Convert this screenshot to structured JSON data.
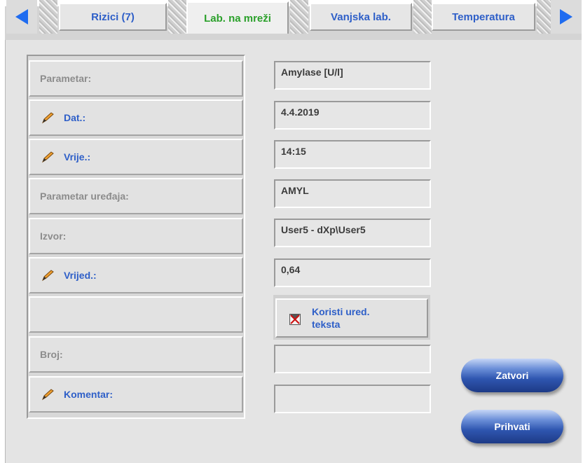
{
  "tabs": [
    {
      "label": "Rizici (7)",
      "active": false
    },
    {
      "label": "Lab. na mreži",
      "active": true
    },
    {
      "label": "Vanjska lab.",
      "active": false
    },
    {
      "label": "Temperatura",
      "active": false
    }
  ],
  "colors": {
    "tab_text": "#2e5fc8",
    "tab_active_text": "#2aa02a",
    "editable_label": "#2e5fc8",
    "static_label": "#8c8c8c",
    "arrow": "#1f6cf0",
    "button_blue": "#2f56b0",
    "checkbox_x": "#cc1010"
  },
  "icons": {
    "prev": "arrow-left-icon",
    "next": "arrow-right-icon",
    "edit": "pencil-icon",
    "checkbox": "checkbox-x-icon"
  },
  "fields": {
    "parameter": {
      "label": "Parametar:",
      "value": "Amylase [U/l]"
    },
    "date": {
      "label": "Dat.:",
      "value": "4.4.2019"
    },
    "time": {
      "label": "Vrije.:",
      "value": "14:15"
    },
    "device_parameter": {
      "label": "Parametar uređaja:",
      "value": "AMYL"
    },
    "source": {
      "label": "Izvor:",
      "value": "User5 - dXp\\User5"
    },
    "value": {
      "label": "Vrijed.:",
      "value": "0,64"
    },
    "number": {
      "label": "Broj:",
      "value": ""
    },
    "comment": {
      "label": "Komentar:",
      "value": ""
    }
  },
  "text_editor": {
    "label": "Koristi ured. teksta",
    "checked": false
  },
  "buttons": {
    "close": "Zatvori",
    "accept": "Prihvati"
  }
}
